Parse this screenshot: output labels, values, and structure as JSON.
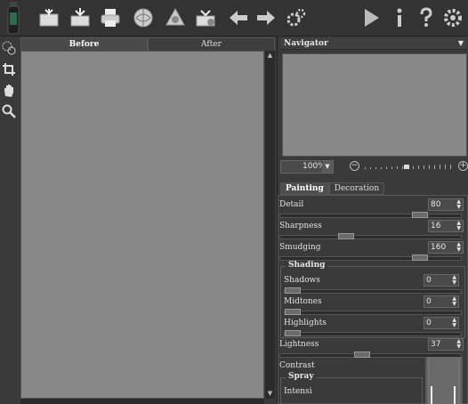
{
  "toolbar": {
    "buttons": [
      "open-icon",
      "save-icon",
      "print-icon",
      "share-icon",
      "batch-icon",
      "export-icon",
      "undo-icon",
      "redo-icon",
      "settings-icon",
      "run-icon",
      "info-icon",
      "help-icon",
      "preferences-icon"
    ]
  },
  "tools": [
    "selection-brush-icon",
    "crop-icon",
    "hand-icon",
    "zoom-icon"
  ],
  "canvas": {
    "tab_before": "Before",
    "tab_after": "After"
  },
  "navigator": {
    "title": "Navigator",
    "zoom_value": "100%"
  },
  "panel": {
    "tab_painting": "Painting",
    "tab_decoration": "Decoration",
    "detail": {
      "label": "Detail",
      "value": "80",
      "level": 0.8
    },
    "sharpness": {
      "label": "Sharpness",
      "value": "16",
      "level": 0.35
    },
    "smudging": {
      "label": "Smudging",
      "value": "160",
      "level": 0.8
    },
    "shading": {
      "title": "Shading",
      "shadows": {
        "label": "Shadows",
        "value": "0",
        "level": 0.0
      },
      "midtones": {
        "label": "Midtones",
        "value": "0",
        "level": 0.0
      },
      "highlights": {
        "label": "Highlights",
        "value": "0",
        "level": 0.0
      }
    },
    "lightness": {
      "label": "Lightness",
      "value": "37",
      "level": 0.45
    },
    "contrast": {
      "label": "Contrast"
    },
    "spray": {
      "title": "Spray",
      "intensity_label": "Intensi"
    }
  }
}
